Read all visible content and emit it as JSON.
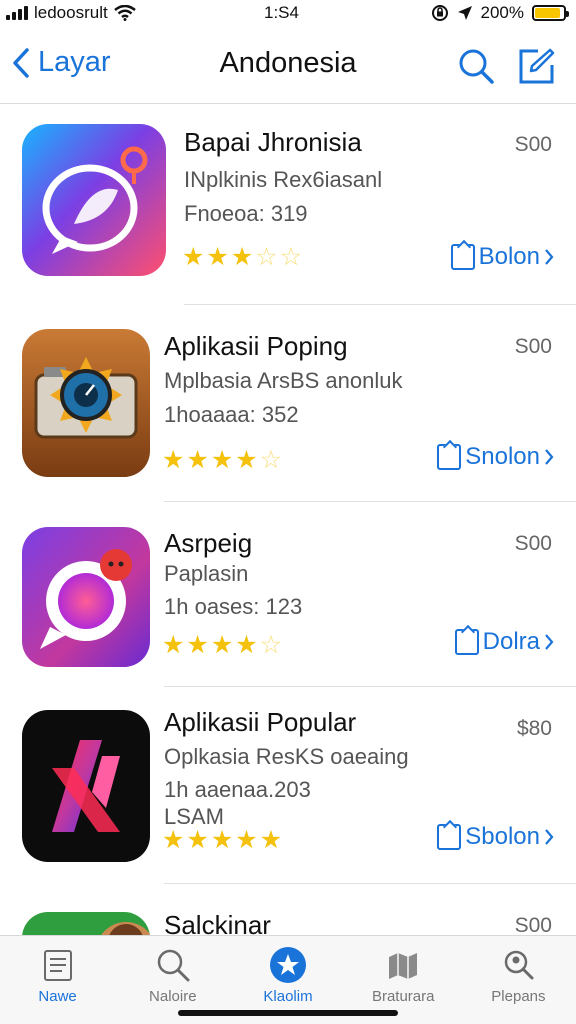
{
  "status_bar": {
    "carrier": "ledoosrult",
    "time": "1:S4",
    "battery": "200%",
    "battery_level": 0.9
  },
  "nav": {
    "back_label": "Layar",
    "title": "Andonesia",
    "search_icon": "search-icon",
    "compose_icon": "compose-icon"
  },
  "apps": [
    {
      "name": "Bapai Jhronisia",
      "subtitle": "INplkinis Rex6iasanl",
      "meta": "Fnoeoa: 319",
      "meta2": "",
      "price": "S00",
      "rating": 3,
      "get_label": "Bolon",
      "accent": "#7b3fe4"
    },
    {
      "name": "Aplikasii Poping",
      "subtitle": "Mplbasia ArsBS anonluk",
      "meta": "1hoaaaa: 352",
      "meta2": "",
      "price": "S00",
      "rating": 4,
      "get_label": "Snolon",
      "accent": "#b5651d"
    },
    {
      "name": "Asrpeig",
      "subtitle": "Paplasin",
      "meta": "1h oases: 123",
      "meta2": "",
      "price": "S00",
      "rating": 4,
      "get_label": "Dolra",
      "accent": "#c2389e"
    },
    {
      "name": "Aplikasii Popular",
      "subtitle": "Oplkasia ResKS oaeaing",
      "meta": "1h aaenaa.203",
      "meta2": "LSAM",
      "price": "$80",
      "rating": 4.5,
      "get_label": "Sbolon",
      "accent": "#e0245e"
    },
    {
      "name": "Salckinar",
      "subtitle": "",
      "meta": "",
      "meta2": "",
      "price": "S00",
      "rating": 0,
      "get_label": "",
      "accent": "#2e9e3f"
    }
  ],
  "tabs": [
    {
      "label": "Nawe",
      "icon": "document-icon",
      "active": true
    },
    {
      "label": "Naloire",
      "icon": "search-icon",
      "active": false
    },
    {
      "label": "Klaolim",
      "icon": "star-badge-icon",
      "active": false
    },
    {
      "label": "Braturara",
      "icon": "map-icon",
      "active": false
    },
    {
      "label": "Plepans",
      "icon": "search-person-icon",
      "active": false
    }
  ],
  "colors": {
    "accent": "#1a73d9",
    "star": "#f4c20d"
  }
}
